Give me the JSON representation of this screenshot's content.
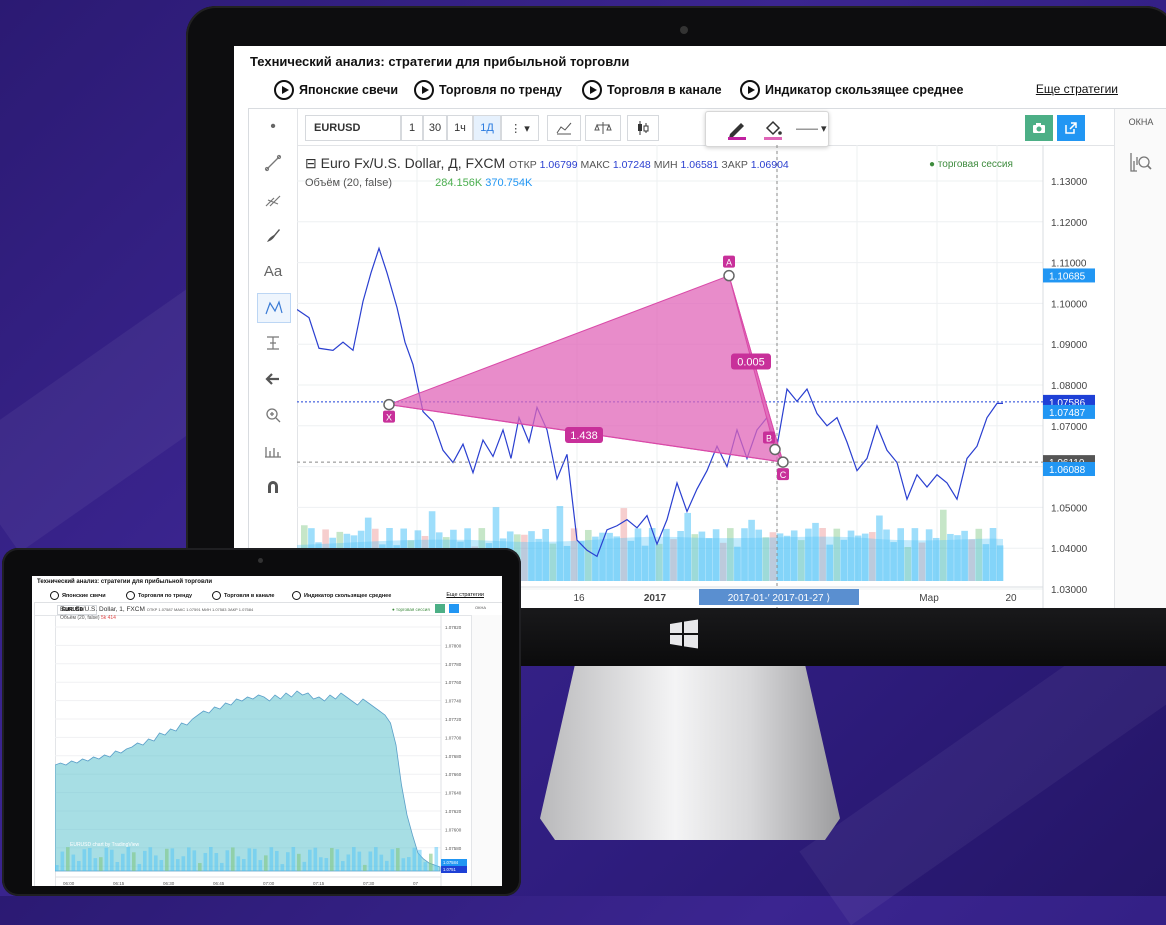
{
  "monitor": {
    "strategies_title": "Технический анализ: стратегии для прибыльной торговли",
    "strategies": [
      {
        "label": "Японские свечи"
      },
      {
        "label": "Торговля по тренду"
      },
      {
        "label": "Торговля в канале"
      },
      {
        "label": "Индикатор скользящее среднее"
      }
    ],
    "more_strategies": "Еще стратегии",
    "toolbar": {
      "symbol": "EURUSD",
      "intervals": [
        "1",
        "30",
        "1ч",
        "1Д"
      ],
      "active_interval": "1Д",
      "windows_label": "ОКНА"
    },
    "legend": {
      "collapse": "⊟",
      "instrument": "Euro Fx/U.S. Dollar, Д, FXCM",
      "open_label": "ОТКР",
      "open": "1.06799",
      "high_label": "МАКС",
      "high": "1.07248",
      "low_label": "МИН",
      "low": "1.06581",
      "close_label": "ЗАКР",
      "close": "1.06904",
      "volume_label": "Объём (20, false)",
      "volume_v1": "284.156K",
      "volume_v2": "370.754K",
      "session": "● торговая сессия"
    },
    "price_axis": [
      "1.13000",
      "1.12000",
      "1.11000",
      "1.10000",
      "1.09000",
      "1.08000",
      "1.07000",
      "1.06000",
      "1.05000",
      "1.04000",
      "1.03000"
    ],
    "price_tags": [
      {
        "label": "1.10685",
        "color": "#2196f3"
      },
      {
        "label": "1.07586",
        "color": "#1e40d6"
      },
      {
        "label": "1.07487",
        "color": "#2196f3"
      },
      {
        "label": "1.06110",
        "color": "#555555"
      },
      {
        "label": "1.06088",
        "color": "#2196f3"
      }
    ],
    "time_axis": [
      {
        "label": "16"
      },
      {
        "label": "2017"
      },
      {
        "label": "2017-01-′ 2017-01-27 ⟩",
        "highlight": true
      },
      {
        "label": "Мар"
      },
      {
        "label": "20"
      }
    ],
    "pattern": {
      "points": [
        "X",
        "A",
        "B",
        "C"
      ],
      "ratios": [
        "1.438",
        "0.005"
      ],
      "fill": "#e066b8"
    }
  },
  "tablet": {
    "strategies_title": "Технический анализ: стратегии для прибыльной торговли",
    "strategies": [
      "Японские свечи",
      "Торговля по тренду",
      "Торговля в канале",
      "Индикатор скользящее среднее"
    ],
    "more_strategies": "Еще стратегии",
    "symbol": "EURUSD",
    "windows_label": "ОКНА",
    "legend": {
      "instrument": "Euro Fx/U.S. Dollar, 1, FXCM",
      "ohlc": "ОТКР 1.07587 МАКС 1.07591 МИН 1.07583 ЗАКР 1.07584",
      "volume": "Объём (20, false)",
      "volume_values": "5k 414",
      "session": "● торговая сессия"
    },
    "price_axis": [
      "1.07820",
      "1.07800",
      "1.07780",
      "1.07760",
      "1.07740",
      "1.07720",
      "1.07700",
      "1.07680",
      "1.07660",
      "1.07640",
      "1.07620",
      "1.07600",
      "1.07580",
      "1.07560"
    ],
    "price_tags": [
      "1.07584",
      "1.0751"
    ],
    "time_axis": [
      "06:00",
      "06:15",
      "06:30",
      "06:45",
      "07:00",
      "07:15",
      "07:30",
      "07"
    ],
    "watermark": "EURUSD chart by TradingView"
  },
  "colors": {
    "accent": "#2196f3",
    "pattern": "#e066b8",
    "line": "#2a3fd0"
  }
}
